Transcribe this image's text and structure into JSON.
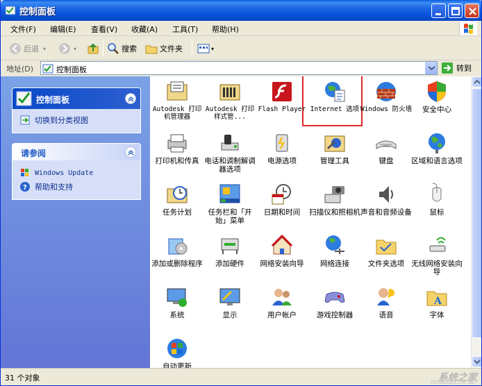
{
  "window": {
    "title": "控制面板"
  },
  "menu": [
    "文件(F)",
    "编辑(E)",
    "查看(V)",
    "收藏(A)",
    "工具(T)",
    "帮助(H)"
  ],
  "toolbar": {
    "back": "后退",
    "search": "搜索",
    "folders": "文件夹"
  },
  "address": {
    "label": "地址(D)",
    "value": "控制面板",
    "go": "转到"
  },
  "left_panel": {
    "cp_title": "控制面板",
    "switch_view": "切换到分类视图",
    "see_also_title": "请参阅",
    "windows_update": "Windows Update",
    "help": "帮助和支持"
  },
  "items": [
    {
      "label": "Autodesk 打印机管理器",
      "icon": "printer-folder-icon"
    },
    {
      "label": "Autodesk 打印样式管...",
      "icon": "plot-styles-icon"
    },
    {
      "label": "Flash Player",
      "icon": "flash-player-icon"
    },
    {
      "label": "Internet 选项",
      "icon": "internet-options-icon"
    },
    {
      "label": "Windows 防火墙",
      "icon": "firewall-icon"
    },
    {
      "label": "安全中心",
      "icon": "security-shield-icon"
    },
    {
      "label": "打印机和传真",
      "icon": "printer-icon"
    },
    {
      "label": "电话和调制解调器选项",
      "icon": "phone-modem-icon"
    },
    {
      "label": "电源选项",
      "icon": "power-icon"
    },
    {
      "label": "管理工具",
      "icon": "admin-tools-icon"
    },
    {
      "label": "键盘",
      "icon": "keyboard-icon"
    },
    {
      "label": "区域和语言选项",
      "icon": "globe-icon"
    },
    {
      "label": "任务计划",
      "icon": "scheduled-tasks-icon"
    },
    {
      "label": "任务栏和「开始」菜单",
      "icon": "taskbar-icon"
    },
    {
      "label": "日期和时间",
      "icon": "clock-icon"
    },
    {
      "label": "扫描仪和照相机",
      "icon": "scanner-camera-icon"
    },
    {
      "label": "声音和音频设备",
      "icon": "speaker-icon"
    },
    {
      "label": "鼠标",
      "icon": "mouse-icon"
    },
    {
      "label": "添加或删除程序",
      "icon": "add-remove-icon"
    },
    {
      "label": "添加硬件",
      "icon": "hardware-icon"
    },
    {
      "label": "网络安装向导",
      "icon": "network-setup-icon"
    },
    {
      "label": "网络连接",
      "icon": "network-connections-icon"
    },
    {
      "label": "文件夹选项",
      "icon": "folder-options-icon"
    },
    {
      "label": "无线网络安装向导",
      "icon": "wireless-icon"
    },
    {
      "label": "系统",
      "icon": "system-icon"
    },
    {
      "label": "显示",
      "icon": "display-icon"
    },
    {
      "label": "用户帐户",
      "icon": "users-icon"
    },
    {
      "label": "游戏控制器",
      "icon": "gamepad-icon"
    },
    {
      "label": "语音",
      "icon": "speech-icon"
    },
    {
      "label": "字体",
      "icon": "fonts-icon"
    },
    {
      "label": "自动更新",
      "icon": "windows-update-icon"
    }
  ],
  "status": {
    "count": "31 个对象"
  },
  "watermark": {
    "brand": "系统之家",
    "url": "XITONGZHIJIA.NET"
  },
  "colors": {
    "accent": "#0A53D8",
    "highlight": "#E0282A"
  }
}
